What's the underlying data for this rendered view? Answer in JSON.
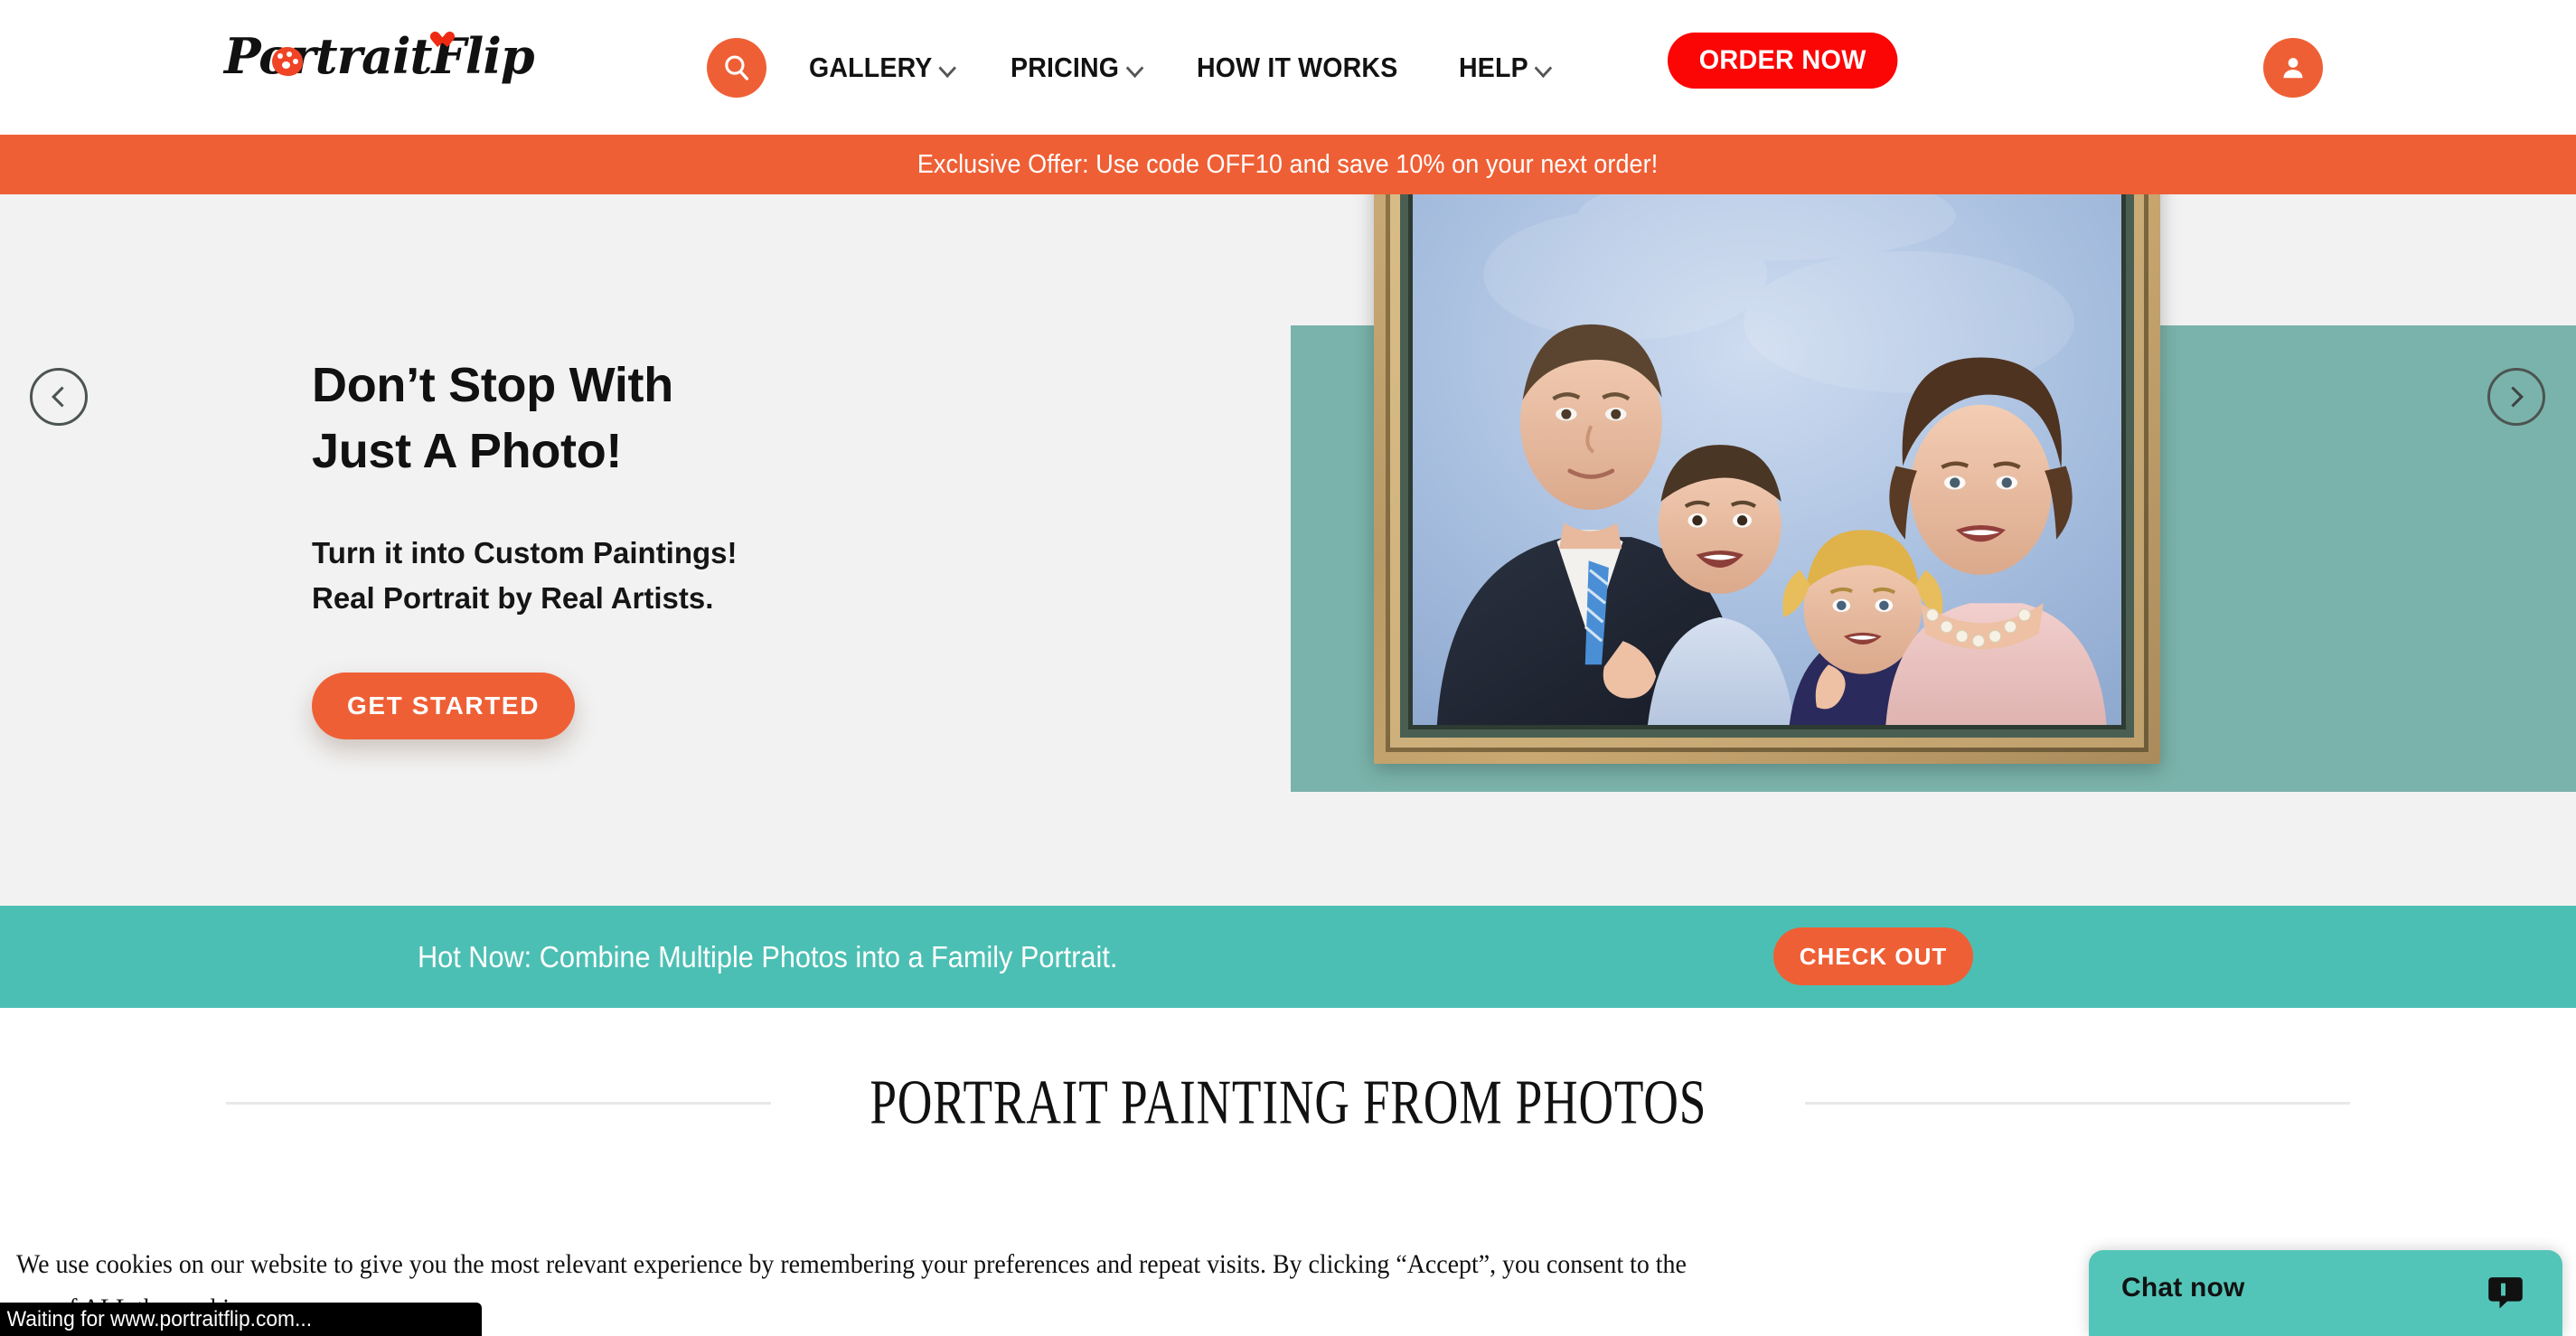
{
  "header": {
    "logo_text": "PortraitFlip",
    "search_icon": "search-icon",
    "nav": [
      {
        "label": "GALLERY",
        "has_dropdown": true
      },
      {
        "label": "PRICING",
        "has_dropdown": true
      },
      {
        "label": "HOW IT WORKS",
        "has_dropdown": false
      },
      {
        "label": "HELP",
        "has_dropdown": true
      }
    ],
    "order_button": "ORDER NOW",
    "account_icon": "user-account-icon"
  },
  "offer_bar": {
    "text": "Exclusive Offer: Use code OFF10 and save 10% on your next order!",
    "background": "#ef5f35"
  },
  "hero": {
    "title_line1": "Don’t Stop With",
    "title_line2": "Just A Photo!",
    "sub_line1": "Turn it into Custom Paintings!",
    "sub_line2": "Real Portrait by Real Artists.",
    "cta": "GET STARTED",
    "prev_arrow": "chevron-left-icon",
    "next_arrow": "chevron-right-icon",
    "slide_count": 2,
    "active_slide": 1,
    "accent_band_color": "#7ab3ab",
    "background": "#f2f2f2",
    "artwork_alt": "Framed family portrait painting"
  },
  "promo": {
    "text": "Hot Now: Combine Multiple Photos into a Family Portrait.",
    "button": "CHECK OUT",
    "background": "#4cbfb4"
  },
  "section": {
    "title": "PORTRAIT PAINTING FROM PHOTOS"
  },
  "cookie": {
    "text": "We use cookies on our website to give you the most relevant experience by remembering your preferences and repeat visits. By clicking “Accept”, you consent to the use of ALL the cookies."
  },
  "chat": {
    "label": "Chat now",
    "icon": "chat-bubble-icon",
    "background": "#53c5b8"
  },
  "status_bar": {
    "text": "Waiting for www.portraitflip.com..."
  },
  "colors": {
    "orange": "#ef5f35",
    "red": "#fc0505",
    "teal": "#4cbfb4",
    "teal_band": "#7ab3ab"
  }
}
